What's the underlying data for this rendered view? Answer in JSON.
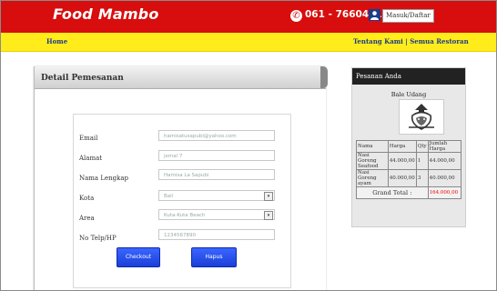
{
  "header": {
    "brand": "Food Mambo",
    "phone": "061 - 76604717",
    "login_label": "Masuk/Daftar"
  },
  "nav": {
    "home": "Home",
    "about": "Tentang Kami",
    "separator": "|",
    "all_restaurants": "Semua Restoran"
  },
  "detail": {
    "title": "Detail Pemesanan",
    "fields": [
      {
        "label": "Email",
        "value": "hamisatusapubi@yahoo.com"
      },
      {
        "label": "Alamat",
        "value": "jemal 7"
      },
      {
        "label": "Nama Lengkap",
        "value": "Hamisa La Sapubi"
      },
      {
        "label": "Kota",
        "value": "Bali"
      },
      {
        "label": "Area",
        "value": "Kuta-Kuta Beach"
      },
      {
        "label": "No Telp/HP",
        "value": "1234567890"
      }
    ],
    "checkout_label": "Checkout",
    "reset_label": "Hapus"
  },
  "order": {
    "title": "Pesanan Anda",
    "restaurant": "Bale Udang",
    "table_headers": [
      "Nama",
      "Harga",
      "Qty",
      "Jumlah Harga"
    ],
    "rows": [
      {
        "name": "Nasi Goreng Seafood",
        "price": "44.000,00",
        "qty": "1",
        "total": "44.000,00"
      },
      {
        "name": "Nasi Goreng ayam",
        "price": "40.000,00",
        "qty": "3",
        "total": "40.000,00"
      }
    ],
    "grand_total_label": "Grand Total :",
    "grand_total_value": "164.000,00"
  },
  "colors": {
    "topbar": "#d80d0d",
    "navbar": "#ffec1a",
    "button": "#1a3fd8",
    "total": "#ee0000"
  }
}
